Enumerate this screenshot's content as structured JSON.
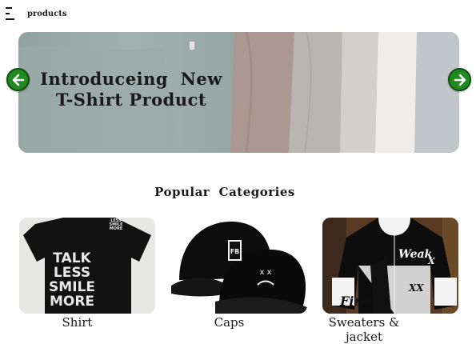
{
  "nav": {
    "menu_icon": "hamburger-menu-icon",
    "link_label": "products"
  },
  "hero": {
    "title_line1": "Introduceing  New",
    "title_line2": "T-Shirt Product",
    "prev_icon": "arrow-left-icon",
    "next_icon": "arrow-right-icon",
    "arrow_color": "#1f8a1f"
  },
  "categories": {
    "title": "Popular  Categories",
    "items": [
      {
        "label": "Shirt",
        "image_text": [
          "TALK",
          "LESS",
          "SMILE",
          "MORE"
        ],
        "tag_text": [
          "LESS",
          "SMILE",
          "MORE"
        ]
      },
      {
        "label": "Caps",
        "badge_text": "FB",
        "face_text": "x x"
      },
      {
        "label": "Sweaters  &  jacket",
        "image_text": [
          "Weak",
          "X",
          "Fire",
          "XX"
        ]
      }
    ]
  }
}
